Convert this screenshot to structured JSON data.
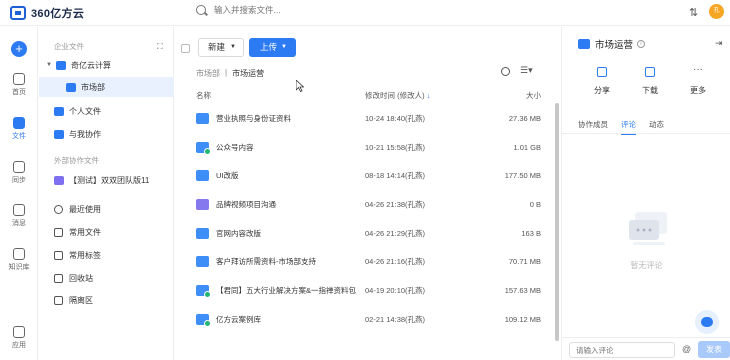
{
  "app": {
    "logo_text": "360亿方云",
    "search_placeholder": "输入并搜索文件...",
    "avatar_text": "孔"
  },
  "rail": [
    {
      "label": "首页",
      "active": false
    },
    {
      "label": "文件",
      "active": true
    },
    {
      "label": "同步",
      "active": false
    },
    {
      "label": "消息",
      "active": false
    },
    {
      "label": "知识库",
      "active": false
    },
    {
      "label": "应用",
      "active": false
    }
  ],
  "sidebar": {
    "enterprise_label": "企业文件",
    "root_item": "奇亿云计算",
    "selected_item": "市场部",
    "personal": "个人文件",
    "shared": "与我协作",
    "external_label": "外部协作文件",
    "external_item": "【测试】双双团队版11",
    "recent": "最近使用",
    "common_files": "常用文件",
    "common_tags": "常用标签",
    "recycle": "回收站",
    "quarantine": "隔离区"
  },
  "toolbar": {
    "new_label": "新建",
    "upload_label": "上传"
  },
  "breadcrumb": {
    "parent": "市场部",
    "separator": "|",
    "current": "市场运营"
  },
  "columns": {
    "name": "名称",
    "time": "修改时间 (修改人)",
    "size": "大小"
  },
  "files": [
    {
      "name": "营业执照与身份证资料",
      "time": "10-24 18:40(孔燕)",
      "size": "27.36 MB",
      "icon": "blue"
    },
    {
      "name": "公众号内容",
      "time": "10-21 15:58(孔燕)",
      "size": "1.01 GB",
      "icon": "blue-share"
    },
    {
      "name": "UI改版",
      "time": "08-18 14:14(孔燕)",
      "size": "177.50 MB",
      "icon": "blue"
    },
    {
      "name": "品牌视频项目沟通",
      "time": "04-26 21:38(孔燕)",
      "size": "0 B",
      "icon": "purple"
    },
    {
      "name": "官网内容改版",
      "time": "04-26 21:29(孔燕)",
      "size": "163 B",
      "icon": "blue"
    },
    {
      "name": "客户拜访所需资料-市场部支持",
      "time": "04-26 21:16(孔燕)",
      "size": "70.71 MB",
      "icon": "blue"
    },
    {
      "name": "【君同】五大行业解决方案&一指禅资料包",
      "time": "04-19 20:10(孔燕)",
      "size": "157.63 MB",
      "icon": "blue-share"
    },
    {
      "name": "亿方云案例库",
      "time": "02-21 14:38(孔燕)",
      "size": "109.12 MB",
      "icon": "blue"
    }
  ],
  "panel": {
    "title": "市场运营",
    "actions": [
      "分享",
      "下载",
      "更多"
    ],
    "tabs": [
      "协作成员",
      "评论",
      "动态"
    ],
    "active_tab": "评论",
    "empty_text": "暂无评论",
    "comment_placeholder": "请输入评论",
    "at_symbol": "@",
    "send_label": "发表"
  },
  "colors": {
    "accent": "#2d7bf2",
    "folder_blue": "#3d8ef7",
    "folder_purple": "#8577ee"
  }
}
